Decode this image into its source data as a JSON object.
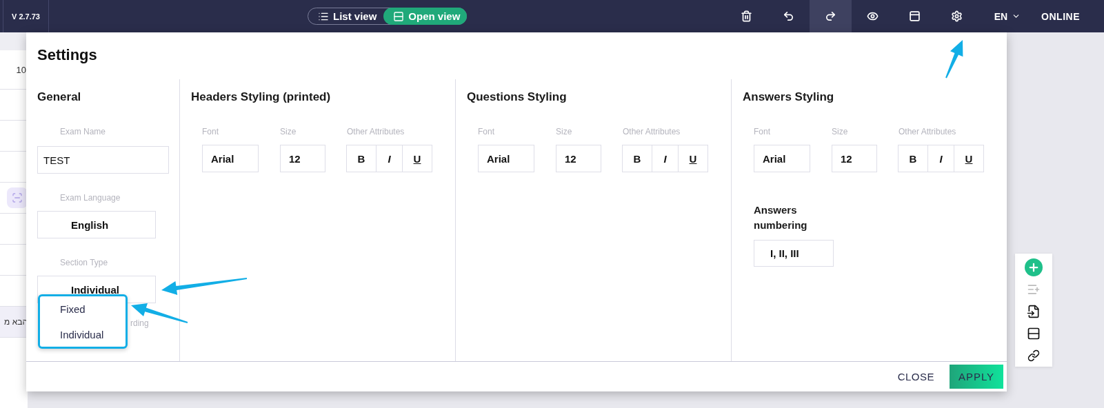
{
  "topbar": {
    "version": "V 2.7.73",
    "view_toggle": [
      {
        "label": "List view",
        "selected": false
      },
      {
        "label": "Open view",
        "selected": true
      }
    ],
    "tools": [
      {
        "kind": "trash",
        "active": false
      },
      {
        "kind": "undo",
        "active": false
      },
      {
        "kind": "redo",
        "active": true
      },
      {
        "kind": "preview",
        "active": false
      },
      {
        "kind": "browser",
        "active": false
      },
      {
        "kind": "settings",
        "active": false
      }
    ],
    "language": "EN",
    "status": "ONLINE"
  },
  "background": {
    "row_number": "10",
    "row_text": "הבא מ"
  },
  "settings": {
    "title": "Settings",
    "general": {
      "title": "General",
      "fields": [
        {
          "label": "Exam Name",
          "value": "TEST",
          "kind": "input"
        },
        {
          "label": "Exam Language",
          "value": "English",
          "kind": "select"
        },
        {
          "label": "Section Type",
          "value": "Individual",
          "kind": "select"
        }
      ],
      "covered_label": "rding",
      "dropdown": [
        {
          "label": "Fixed"
        },
        {
          "label": "Individual"
        }
      ]
    },
    "styling": [
      {
        "title": "Headers Styling (printed)",
        "font_label": "Font",
        "font": "Arial",
        "size_label": "Size",
        "size": "12",
        "attributes_label": "Other Attributes",
        "attributes": [
          "B",
          "I",
          "U"
        ]
      },
      {
        "title": "Questions Styling",
        "font_label": "Font",
        "font": "Arial",
        "size_label": "Size",
        "size": "12",
        "attributes_label": "Other Attributes",
        "attributes": [
          "B",
          "I",
          "U"
        ]
      },
      {
        "title": "Answers Styling",
        "font_label": "Font",
        "font": "Arial",
        "size_label": "Size",
        "size": "12",
        "attributes_label": "Other Attributes",
        "attributes": [
          "B",
          "I",
          "U"
        ],
        "numbering": {
          "label": "Answers numbering",
          "value": "I, II, III"
        }
      }
    ],
    "buttons": [
      "CLOSE",
      "APPLY"
    ]
  }
}
